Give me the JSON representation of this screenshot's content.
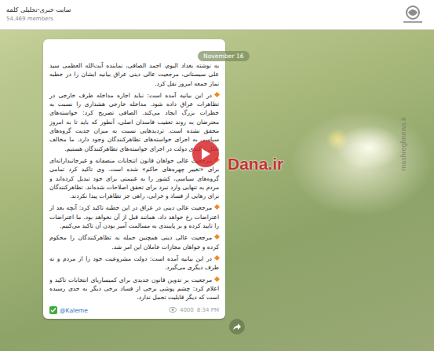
{
  "channel": {
    "title": "سایت خبری-تحلیلی کلمه",
    "members": "54,469 members"
  },
  "date_badge": "November 16",
  "message": {
    "paragraphs": [
      {
        "kind": "plain",
        "text": "به نوشته بغداد الیوم، احمد الصافی، نماینده آیت‌الله العظمی سید علی سیستانی، مرجعیت عالی دینی عراق بیانیه ایشان را در خطبه نماز جمعه امروز نقل کرد."
      },
      {
        "kind": "bullet",
        "text": "در این بیانیه آمده است: نباید اجازه مداخله طرف خارجی در تظاهرات عراق داده شود. مداخله خارجی هشداری را نسبت به خطرات بزرگ ایجاد می‌کند. الصافی تصریح کرد: خواسته‌های معترضان به روند تعقیب فاسدان اصلی، آنطور که باید تا به امروز محقق نشده است. تردیدهایی نسبت به میزان جدیت گروه‌های سیاسی به اجرای خواسته‌های تظاهرکنندگان وجود دارد. ما مخالف تعلل و کندی دولت در اجرای خواسته‌های تظاهرکنندگان هستیم."
      },
      {
        "kind": "bullet",
        "text": "مرجعیت عالی خواهان قانون انتخابات منصفانه و غیرجانبدارانه‌ای برای «تغییر چهره‌های حاکم» شده است. وی تاکید کرد تمامی گروه‌های سیاسی، کشور را به غنیمتی برای خود تبدیل کرده‌اند و مردم به تنهایی وارد نبرد برای تحقق اصلاحات شده‌اند. تظاهرکنندگان برای رهایی از فساد و خرابی، راهی جز تظاهرات پیدا نکردند."
      },
      {
        "kind": "bullet",
        "text": "مرجعیت عالی دینی در عراق در این خطبه تاکید کرد: آنچه بعد از اعتراضات رخ خواهد داد، همانند قبل از آن نخواهد بود. ما اعتراضات را تایید کرده و بر پایبندی به مسالمت آمیز بودن آن تاکید می‌کنیم."
      },
      {
        "kind": "bullet",
        "text": "مرجعیت عالی دینی همچنین حمله به تظاهرکنندگان را محکوم کرده و خواهان مجازات عاملان این امر شد."
      },
      {
        "kind": "bullet",
        "text": "در این بیانیه آمده است: دولت مشروعیت خود را از مردم و نه طرف دیگری می‌گیرد."
      },
      {
        "kind": "bullet",
        "text": "مرجعیت بر تدوین قانون جدیدی برای کمیساریای انتخابات تاکید و اعلام کرد: چشم پوشی برخی از فساد برخی دیگر به حدی رسیده است که دیگر قابلیت تحمل ندارد."
      }
    ],
    "signature": "@Kaleme",
    "views": "4000",
    "time": "8:34 PM"
  },
  "watermarks": {
    "video": "Dana.ir",
    "side": "mashreghnews.ir"
  }
}
